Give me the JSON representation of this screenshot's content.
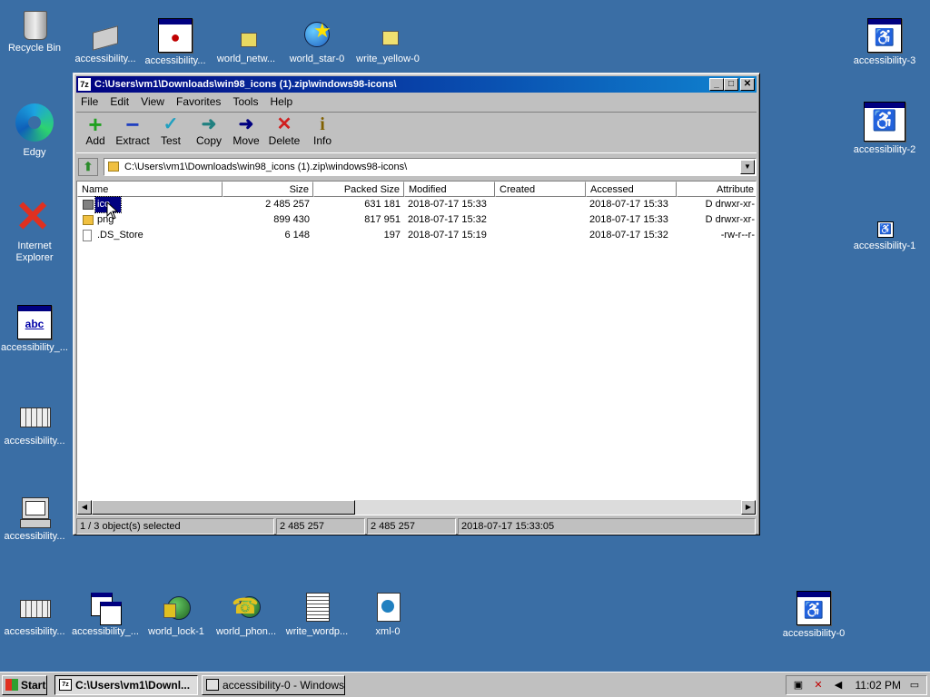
{
  "desktop": {
    "icons": [
      {
        "label": "Recycle Bin",
        "icon": "recycle-bin-icon"
      },
      {
        "label": "accessibility...",
        "icon": "accessibility-icon"
      },
      {
        "label": "accessibility...",
        "icon": "accessibility-window-icon"
      },
      {
        "label": "world_netw...",
        "icon": "world-network-icon"
      },
      {
        "label": "world_star-0",
        "icon": "world-star-icon"
      },
      {
        "label": "write_yellow-0",
        "icon": "write-yellow-icon"
      },
      {
        "label": "accessibility-3",
        "icon": "accessibility-icon"
      },
      {
        "label": "Edgy",
        "icon": "edge-icon"
      },
      {
        "label": "accessibility-2",
        "icon": "accessibility-icon"
      },
      {
        "label": "Internet Explorer",
        "icon": "internet-explorer-icon"
      },
      {
        "label": "accessibility-1",
        "icon": "accessibility-icon"
      },
      {
        "label": "accessibility_...",
        "icon": "abc-icon"
      },
      {
        "label": "accessibility...",
        "icon": "keyboard-icon"
      },
      {
        "label": "accessibility...",
        "icon": "computer-icon"
      },
      {
        "label": "accessibility...",
        "icon": "keyboard-icon"
      },
      {
        "label": "accessibility_...",
        "icon": "windows-icon"
      },
      {
        "label": "world_lock-1",
        "icon": "world-lock-icon"
      },
      {
        "label": "world_phon...",
        "icon": "world-phone-icon"
      },
      {
        "label": "write_wordp...",
        "icon": "write-wordpad-icon"
      },
      {
        "label": "xml-0",
        "icon": "xml-icon"
      },
      {
        "label": "accessibility-0",
        "icon": "accessibility-icon"
      }
    ]
  },
  "window": {
    "title": "C:\\Users\\vm1\\Downloads\\win98_icons (1).zip\\windows98-icons\\",
    "app_icon_text": "7z",
    "menu": [
      "File",
      "Edit",
      "View",
      "Favorites",
      "Tools",
      "Help"
    ],
    "toolbar": [
      {
        "label": "Add",
        "icon": "add-icon",
        "glyph": "+",
        "color": "#20a020"
      },
      {
        "label": "Extract",
        "icon": "extract-icon",
        "glyph": "−",
        "color": "#2040c0"
      },
      {
        "label": "Test",
        "icon": "test-icon",
        "glyph": "✓",
        "color": "#20a0c0"
      },
      {
        "label": "Copy",
        "icon": "copy-icon",
        "glyph": "➜",
        "color": "#208080"
      },
      {
        "label": "Move",
        "icon": "move-icon",
        "glyph": "➜",
        "color": "#000080"
      },
      {
        "label": "Delete",
        "icon": "delete-icon",
        "glyph": "✕",
        "color": "#d02020"
      },
      {
        "label": "Info",
        "icon": "info-icon",
        "glyph": "i",
        "color": "#806000"
      }
    ],
    "address": "C:\\Users\\vm1\\Downloads\\win98_icons (1).zip\\windows98-icons\\",
    "columns": [
      "Name",
      "Size",
      "Packed Size",
      "Modified",
      "Created",
      "Accessed",
      "Attribute"
    ],
    "rows": [
      {
        "name": "ico",
        "size": "2 485 257",
        "packed": "631 181",
        "modified": "2018-07-17 15:33",
        "created": "",
        "accessed": "2018-07-17 15:33",
        "attr": "D drwxr-xr-",
        "type": "folder",
        "selected": true
      },
      {
        "name": "png",
        "size": "899 430",
        "packed": "817 951",
        "modified": "2018-07-17 15:32",
        "created": "",
        "accessed": "2018-07-17 15:33",
        "attr": "D drwxr-xr-",
        "type": "folder",
        "selected": false
      },
      {
        "name": ".DS_Store",
        "size": "6 148",
        "packed": "197",
        "modified": "2018-07-17 15:19",
        "created": "",
        "accessed": "2018-07-17 15:32",
        "attr": "-rw-r--r-",
        "type": "file",
        "selected": false
      }
    ],
    "status": {
      "selection": "1 / 3 object(s) selected",
      "size": "2 485 257",
      "packed": "2 485 257",
      "modified": "2018-07-17 15:33:05"
    }
  },
  "taskbar": {
    "start_label": "Start",
    "tasks": [
      {
        "label": "C:\\Users\\vm1\\Downl...",
        "active": true
      },
      {
        "label": "accessibility-0 - Windows...",
        "active": false
      }
    ],
    "clock": "11:02 PM"
  },
  "colors": {
    "desktop": "#3a6ea5",
    "title_start": "#000080",
    "title_end": "#1084d0",
    "face": "#c0c0c0"
  }
}
